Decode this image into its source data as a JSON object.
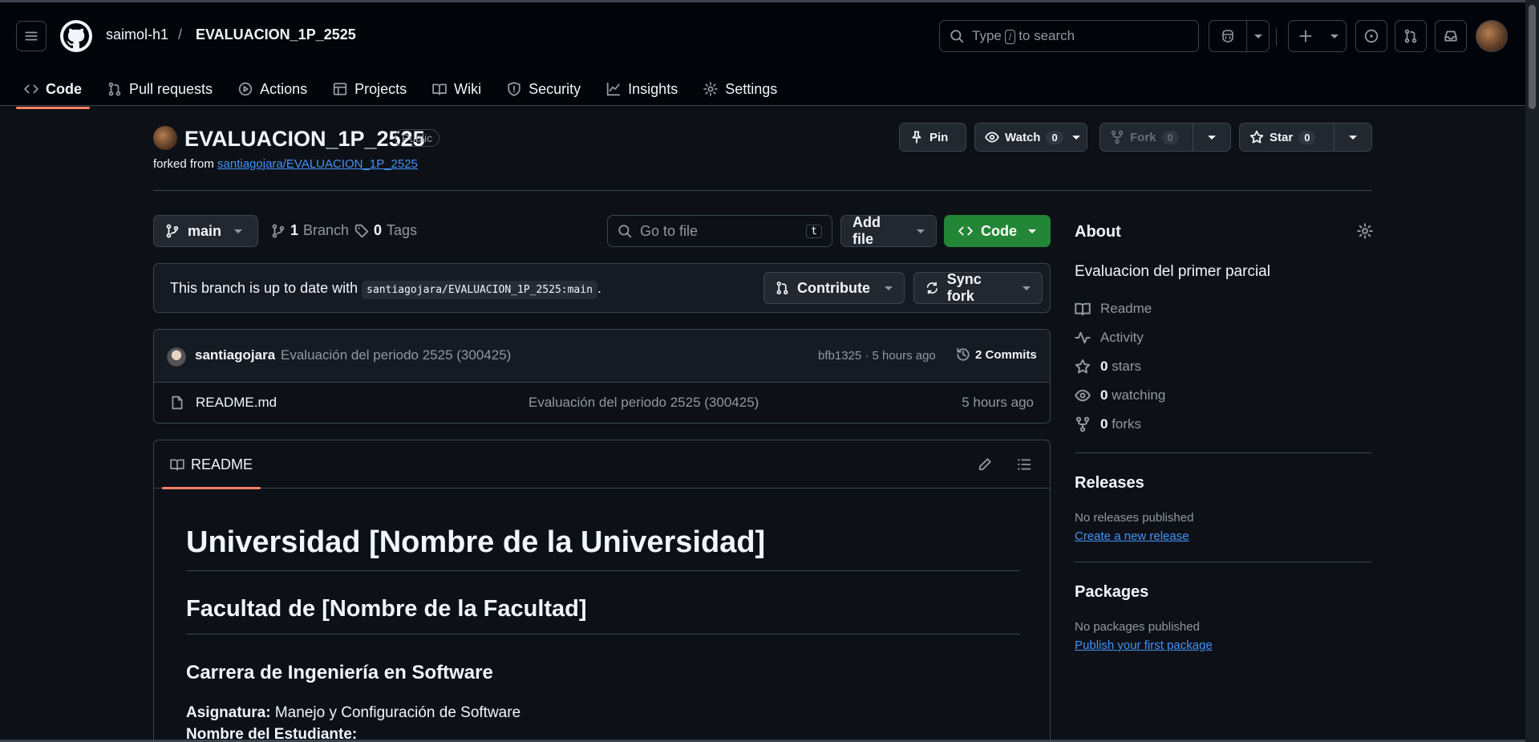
{
  "header": {
    "user": "saimol-h1",
    "separator": "/",
    "repo": "EVALUACION_1P_2525",
    "search_pre": "Type",
    "search_key": "/",
    "search_post": "to search"
  },
  "tabs": [
    {
      "label": "Code"
    },
    {
      "label": "Pull requests"
    },
    {
      "label": "Actions"
    },
    {
      "label": "Projects"
    },
    {
      "label": "Wiki"
    },
    {
      "label": "Security"
    },
    {
      "label": "Insights"
    },
    {
      "label": "Settings"
    }
  ],
  "repo": {
    "name": "EVALUACION_1P_2525",
    "visibility": "Public",
    "forked_prefix": "forked from",
    "forked_from": "santiagojara/EVALUACION_1P_2525"
  },
  "actions": {
    "pin": "Pin",
    "watch": "Watch",
    "watch_count": "0",
    "fork": "Fork",
    "fork_count": "0",
    "star": "Star",
    "star_count": "0"
  },
  "branchbar": {
    "branch": "main",
    "branches_count": "1",
    "branches_label": "Branch",
    "tags_count": "0",
    "tags_label": "Tags",
    "goto_placeholder": "Go to file",
    "goto_key": "t",
    "add_file": "Add file",
    "code": "Code"
  },
  "sync": {
    "text": "This branch is up to date with",
    "ref": "santiagojara/EVALUACION_1P_2525:main",
    "period": ".",
    "contribute": "Contribute",
    "sync_fork": "Sync fork"
  },
  "commit": {
    "author": "santiagojara",
    "message": "Evaluación del periodo 2525 (300425)",
    "hash_time": "bfb1325 · 5 hours ago",
    "commits": "2 Commits"
  },
  "files": [
    {
      "name": "README.md",
      "message": "Evaluación del periodo 2525 (300425)",
      "time": "5 hours ago"
    }
  ],
  "readme": {
    "tab": "README",
    "h1": "Universidad [Nombre de la Universidad]",
    "h2": "Facultad de [Nombre de la Facultad]",
    "h3": "Carrera de Ingeniería en Software",
    "subject_label": "Asignatura:",
    "subject_value": "Manejo y Configuración de Software",
    "student_label": "Nombre del Estudiante:"
  },
  "about": {
    "title": "About",
    "description": "Evaluacion del primer parcial",
    "readme": "Readme",
    "activity": "Activity",
    "stars_count": "0",
    "stars_label": "stars",
    "watching_count": "0",
    "watching_label": "watching",
    "forks_count": "0",
    "forks_label": "forks"
  },
  "releases": {
    "title": "Releases",
    "none": "No releases published",
    "link": "Create a new release"
  },
  "packages": {
    "title": "Packages",
    "none": "No packages published",
    "link": "Publish your first package"
  },
  "colors": {
    "background": "#0d1117",
    "header": "#010409",
    "accent_underline": "#f78166",
    "link": "#4493f8",
    "primary_button": "#238636"
  }
}
